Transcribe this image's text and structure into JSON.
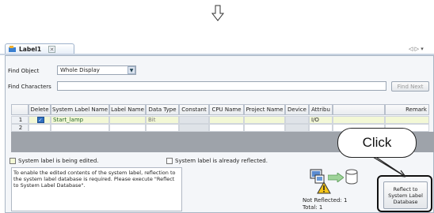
{
  "tab": {
    "title": "Label1"
  },
  "find": {
    "object_label": "Find Object",
    "object_value": "Whole Display",
    "chars_label": "Find Characters",
    "chars_value": "",
    "next_label": "Find Next"
  },
  "table": {
    "headers": [
      "",
      "Delete",
      "System Label Name",
      "Label Name",
      "Data Type",
      "Constant",
      "CPU Name",
      "Project Name",
      "Device",
      "Attribu",
      "Remark"
    ],
    "rows": [
      {
        "num": "1",
        "checked": true,
        "system_label": "Start_lamp",
        "data_type": "Bit",
        "attr": "I/O"
      },
      {
        "num": "2",
        "checked": false,
        "system_label": "",
        "data_type": "",
        "attr": ""
      }
    ]
  },
  "legend": {
    "editing": "System label is being edited.",
    "reflected": "System label is already reflected."
  },
  "message": "To enable the edited contents of the system label, reflection to the system label database is required. Please execute \"Reflect to System Label Database\".",
  "status": {
    "not_reflected": "Not Reflected: 1",
    "total": "Total: 1"
  },
  "reflect_button": "Reflect to System Label Database",
  "callout": "Click",
  "icons": {
    "down_arrow": "down-arrow-outline-icon",
    "label": "label-tab-icon",
    "close": "close-icon",
    "warning": "warning-icon",
    "computer": "computer-icon",
    "database": "database-icon"
  }
}
